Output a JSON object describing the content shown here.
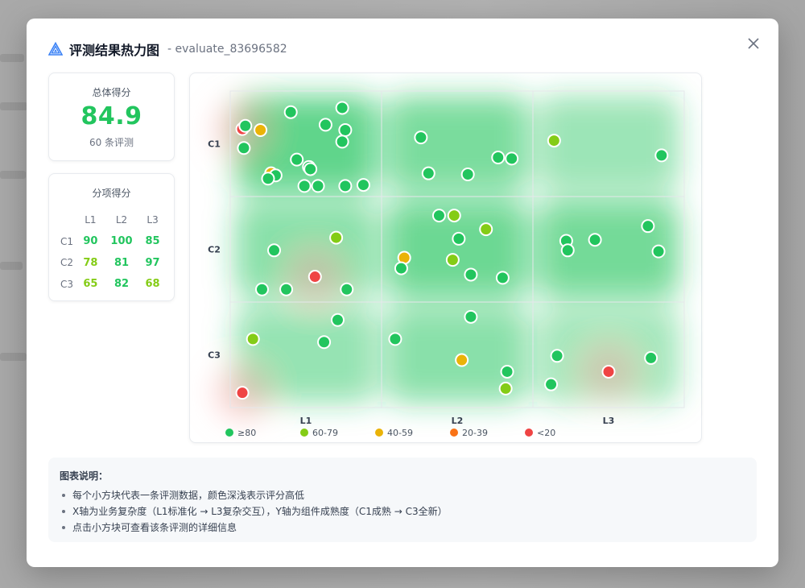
{
  "header": {
    "title": "评测结果热力图",
    "subtitle": "- evaluate_83696582"
  },
  "summary": {
    "label": "总体得分",
    "value": "84.9",
    "count": "60 条评测"
  },
  "subscores": {
    "title": "分项得分",
    "columns": [
      "L1",
      "L2",
      "L3"
    ],
    "rows": [
      {
        "label": "C1",
        "values": [
          "90",
          "100",
          "85"
        ],
        "colors": [
          "#22c55e",
          "#22c55e",
          "#22c55e"
        ]
      },
      {
        "label": "C2",
        "values": [
          "78",
          "81",
          "97"
        ],
        "colors": [
          "#84cc16",
          "#22c55e",
          "#22c55e"
        ]
      },
      {
        "label": "C3",
        "values": [
          "65",
          "82",
          "68"
        ],
        "colors": [
          "#84cc16",
          "#22c55e",
          "#84cc16"
        ]
      }
    ]
  },
  "chart_data": {
    "type": "scatter",
    "x_categories": [
      "L1",
      "L2",
      "L3"
    ],
    "y_categories": [
      "C1",
      "C2",
      "C3"
    ],
    "xlim": [
      0,
      3
    ],
    "ylim": [
      0,
      3
    ],
    "legend": [
      {
        "label": "≥80",
        "color": "#22c55e"
      },
      {
        "label": "60-79",
        "color": "#84cc16"
      },
      {
        "label": "40-59",
        "color": "#eab308"
      },
      {
        "label": "20-39",
        "color": "#f97316"
      },
      {
        "label": "<20",
        "color": "#ef4444"
      }
    ],
    "cell_heat": [
      {
        "col": 0,
        "row": 0,
        "intensity": 0.95
      },
      {
        "col": 1,
        "row": 0,
        "intensity": 0.75
      },
      {
        "col": 2,
        "row": 0,
        "intensity": 0.45
      },
      {
        "col": 0,
        "row": 1,
        "intensity": 0.6
      },
      {
        "col": 1,
        "row": 1,
        "intensity": 0.85
      },
      {
        "col": 2,
        "row": 1,
        "intensity": 0.8
      },
      {
        "col": 0,
        "row": 2,
        "intensity": 0.5
      },
      {
        "col": 1,
        "row": 2,
        "intensity": 0.6
      },
      {
        "col": 2,
        "row": 2,
        "intensity": 0.4
      }
    ],
    "points": [
      [
        0.08,
        0.36,
        "r"
      ],
      [
        0.1,
        0.33,
        "g"
      ],
      [
        0.2,
        0.37,
        "y"
      ],
      [
        0.09,
        0.54,
        "g"
      ],
      [
        0.4,
        0.2,
        "g"
      ],
      [
        0.74,
        0.16,
        "g"
      ],
      [
        0.63,
        0.32,
        "g"
      ],
      [
        0.76,
        0.37,
        "g"
      ],
      [
        0.74,
        0.48,
        "g"
      ],
      [
        0.44,
        0.65,
        "g"
      ],
      [
        0.52,
        0.72,
        "g"
      ],
      [
        0.27,
        0.78,
        "y"
      ],
      [
        0.3,
        0.8,
        "g"
      ],
      [
        0.25,
        0.83,
        "g"
      ],
      [
        0.49,
        0.9,
        "g"
      ],
      [
        0.58,
        0.9,
        "g"
      ],
      [
        0.76,
        0.9,
        "g"
      ],
      [
        0.88,
        0.89,
        "g"
      ],
      [
        0.53,
        0.74,
        "g"
      ],
      [
        1.26,
        0.44,
        "g"
      ],
      [
        1.31,
        0.78,
        "g"
      ],
      [
        1.57,
        0.79,
        "g"
      ],
      [
        1.77,
        0.63,
        "g"
      ],
      [
        1.86,
        0.64,
        "g"
      ],
      [
        2.14,
        0.47,
        "lg"
      ],
      [
        2.85,
        0.61,
        "g"
      ],
      [
        1.38,
        1.18,
        "g"
      ],
      [
        1.48,
        1.18,
        "lg"
      ],
      [
        1.51,
        1.4,
        "g"
      ],
      [
        1.69,
        1.31,
        "lg"
      ],
      [
        1.15,
        1.58,
        "y"
      ],
      [
        1.13,
        1.68,
        "g"
      ],
      [
        1.47,
        1.6,
        "lg"
      ],
      [
        1.59,
        1.74,
        "g"
      ],
      [
        1.8,
        1.77,
        "g"
      ],
      [
        0.7,
        1.39,
        "lg"
      ],
      [
        0.29,
        1.51,
        "g"
      ],
      [
        0.56,
        1.76,
        "r"
      ],
      [
        0.21,
        1.88,
        "g"
      ],
      [
        0.37,
        1.88,
        "g"
      ],
      [
        0.77,
        1.88,
        "g"
      ],
      [
        2.22,
        1.42,
        "g"
      ],
      [
        2.23,
        1.51,
        "g"
      ],
      [
        2.41,
        1.41,
        "g"
      ],
      [
        2.76,
        1.28,
        "g"
      ],
      [
        2.83,
        1.52,
        "g"
      ],
      [
        0.71,
        2.17,
        "g"
      ],
      [
        0.15,
        2.35,
        "lg"
      ],
      [
        0.62,
        2.38,
        "g"
      ],
      [
        1.09,
        2.35,
        "g"
      ],
      [
        1.59,
        2.14,
        "g"
      ],
      [
        1.53,
        2.55,
        "y"
      ],
      [
        1.83,
        2.66,
        "g"
      ],
      [
        2.16,
        2.51,
        "g"
      ],
      [
        2.5,
        2.66,
        "r"
      ],
      [
        2.78,
        2.53,
        "g"
      ],
      [
        1.82,
        2.82,
        "lg"
      ],
      [
        2.12,
        2.78,
        "g"
      ],
      [
        0.08,
        2.86,
        "r"
      ]
    ]
  },
  "notes": {
    "title": "图表说明：",
    "items": [
      "每个小方块代表一条评测数据，颜色深浅表示评分高低",
      "X轴为业务复杂度（L1标准化 → L3复杂交互），Y轴为组件成熟度（C1成熟 → C3全新）",
      "点击小方块可查看该条评测的详细信息"
    ]
  }
}
